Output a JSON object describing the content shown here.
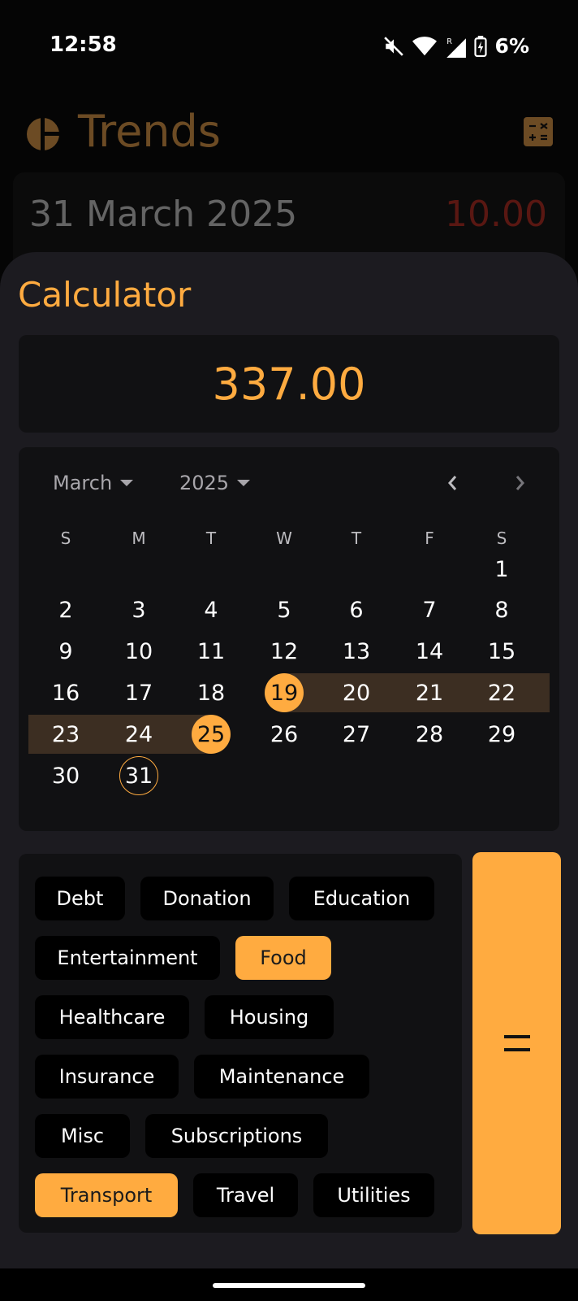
{
  "status": {
    "time": "12:58",
    "battery": "6%"
  },
  "app": {
    "title": "Trends",
    "entry_date": "31 March 2025",
    "entry_amount": "10.00"
  },
  "sheet": {
    "title": "Calculator",
    "display_value": "337.00"
  },
  "calendar": {
    "month": "March",
    "year": "2025",
    "weekdays": [
      "S",
      "M",
      "T",
      "W",
      "T",
      "F",
      "S"
    ],
    "weeks": [
      [
        "",
        "",
        "",
        "",
        "",
        "",
        "1"
      ],
      [
        "2",
        "3",
        "4",
        "5",
        "6",
        "7",
        "8"
      ],
      [
        "9",
        "10",
        "11",
        "12",
        "13",
        "14",
        "15"
      ],
      [
        "16",
        "17",
        "18",
        "19",
        "20",
        "21",
        "22"
      ],
      [
        "23",
        "24",
        "25",
        "26",
        "27",
        "28",
        "29"
      ],
      [
        "30",
        "31",
        "",
        "",
        "",
        "",
        ""
      ]
    ],
    "range_start": "19",
    "range_end": "25",
    "today": "31"
  },
  "categories": [
    {
      "label": "Debt",
      "active": false
    },
    {
      "label": "Donation",
      "active": false
    },
    {
      "label": "Education",
      "active": false
    },
    {
      "label": "Entertainment",
      "active": false
    },
    {
      "label": "Food",
      "active": true
    },
    {
      "label": "Healthcare",
      "active": false
    },
    {
      "label": "Housing",
      "active": false
    },
    {
      "label": "Insurance",
      "active": false
    },
    {
      "label": "Maintenance",
      "active": false
    },
    {
      "label": "Misc",
      "active": false
    },
    {
      "label": "Subscriptions",
      "active": false
    },
    {
      "label": "Transport",
      "active": true
    },
    {
      "label": "Travel",
      "active": false
    },
    {
      "label": "Utilities",
      "active": false
    }
  ],
  "equals_label": "=",
  "colors": {
    "accent": "#ffab40",
    "negative": "#c02e22",
    "sheet_bg": "#1c1b20"
  },
  "icons": [
    "mute-icon",
    "wifi-icon",
    "signal-icon",
    "battery-charging-icon",
    "pie-chart-icon",
    "calculator-icon",
    "chevron-left-icon",
    "chevron-right-icon"
  ]
}
